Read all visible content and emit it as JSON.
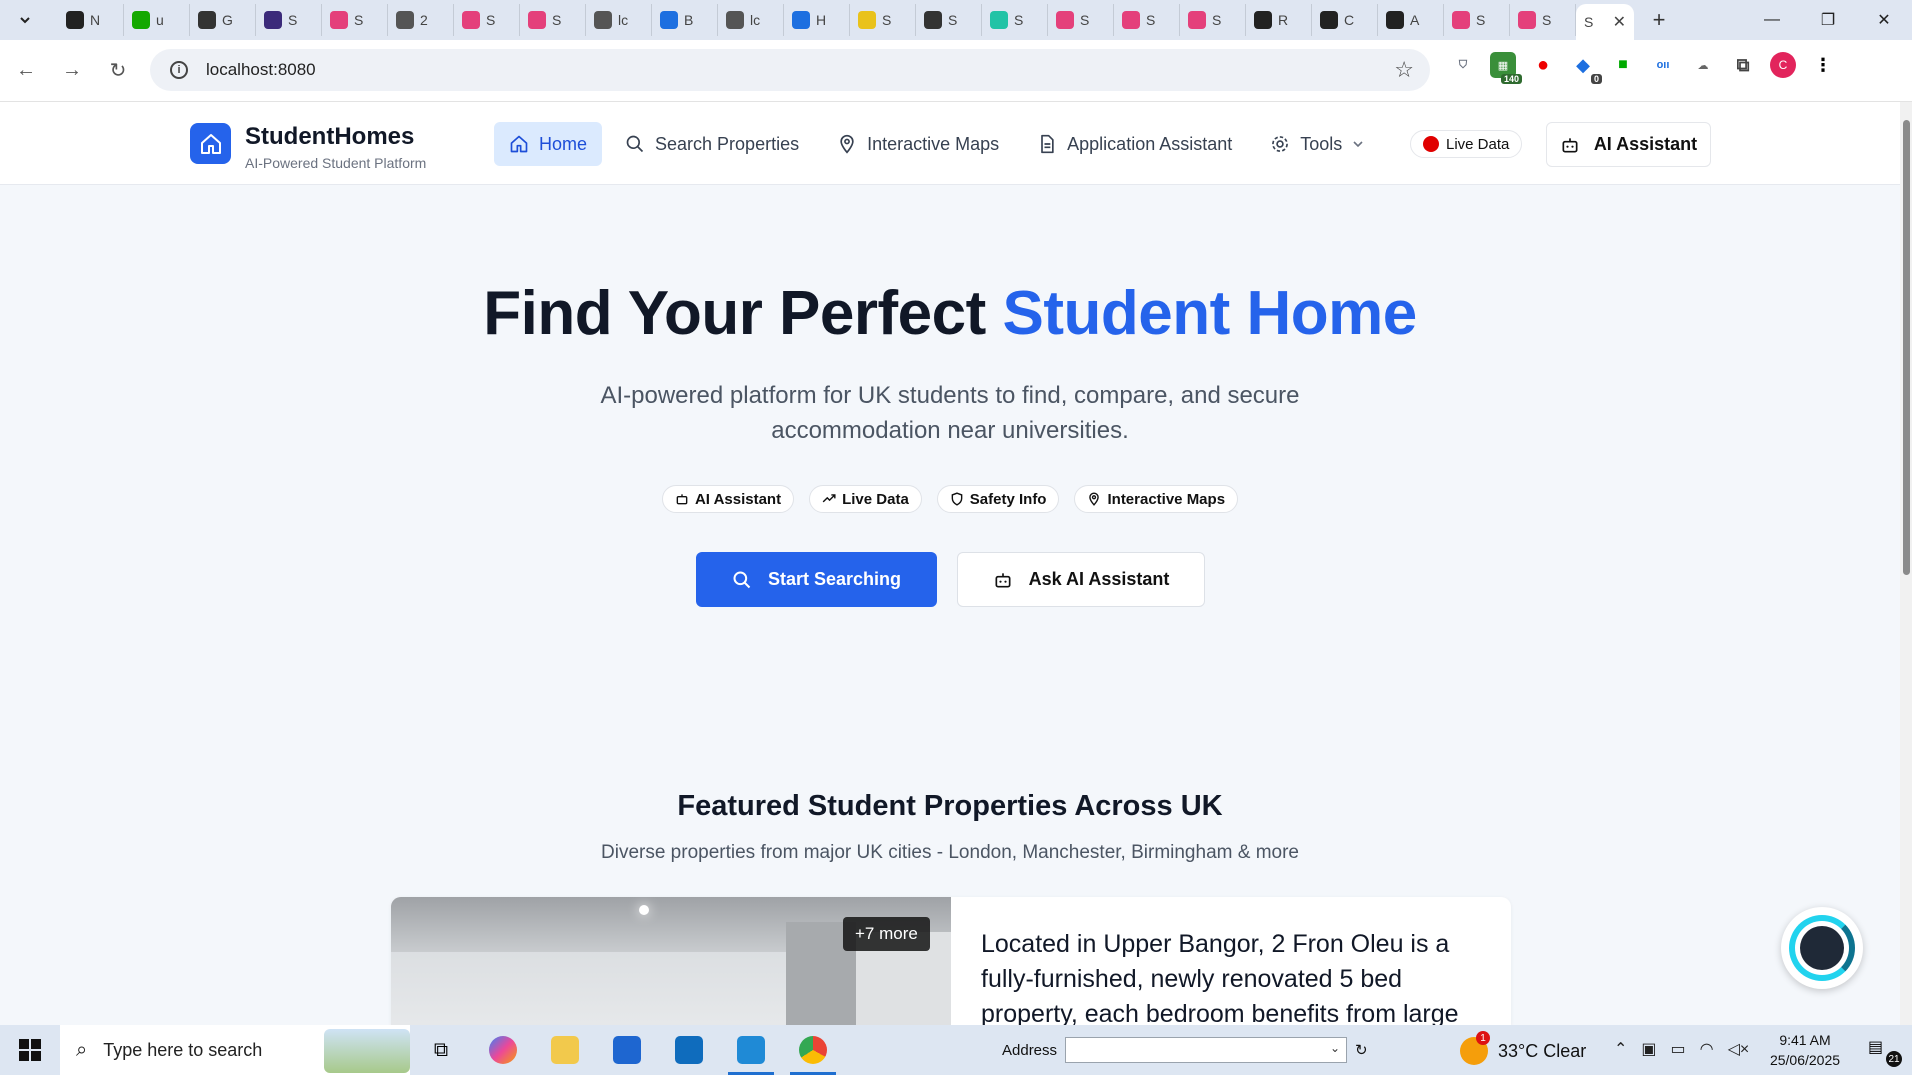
{
  "browser": {
    "tabs": [
      {
        "label": "N",
        "icon": "github-icon",
        "color": "#222222"
      },
      {
        "label": "u",
        "icon": "upwork-icon",
        "color": "#14a800"
      },
      {
        "label": "G",
        "icon": "link-icon",
        "color": "#333333"
      },
      {
        "label": "S",
        "icon": "app-icon",
        "color": "#3b2a7a"
      },
      {
        "label": "S",
        "icon": "lovable-icon",
        "color": "#e4407b"
      },
      {
        "label": "2",
        "icon": "globe-icon",
        "color": "#555555"
      },
      {
        "label": "S",
        "icon": "lovable-icon",
        "color": "#e4407b"
      },
      {
        "label": "S",
        "icon": "lovable-icon",
        "color": "#e4407b"
      },
      {
        "label": "lc",
        "icon": "globe-icon",
        "color": "#555555"
      },
      {
        "label": "B",
        "icon": "info-icon",
        "color": "#1d6fe0"
      },
      {
        "label": "lc",
        "icon": "globe-icon",
        "color": "#555555"
      },
      {
        "label": "H",
        "icon": "history-icon",
        "color": "#1d6fe0"
      },
      {
        "label": "S",
        "icon": "sun-icon",
        "color": "#e9c21b"
      },
      {
        "label": "S",
        "icon": "spiral-icon",
        "color": "#333333"
      },
      {
        "label": "S",
        "icon": "home-icon",
        "color": "#22c3a6"
      },
      {
        "label": "S",
        "icon": "lovable-icon",
        "color": "#e4407b"
      },
      {
        "label": "S",
        "icon": "lovable-icon",
        "color": "#e4407b"
      },
      {
        "label": "S",
        "icon": "lovable-icon",
        "color": "#e4407b"
      },
      {
        "label": "R",
        "icon": "app-icon",
        "color": "#222222"
      },
      {
        "label": "C",
        "icon": "app-icon",
        "color": "#222222"
      },
      {
        "label": "A",
        "icon": "app-icon",
        "color": "#222222"
      },
      {
        "label": "S",
        "icon": "lovable-icon",
        "color": "#e4407b"
      },
      {
        "label": "S",
        "icon": "lovable-icon",
        "color": "#e4407b"
      }
    ],
    "active_tab_label": "S",
    "url": "localhost:8080",
    "ext_badge_1": "140",
    "ext_badge_2": "0",
    "profile_initial": "C"
  },
  "header": {
    "brand_title": "StudentHomes",
    "brand_subtitle": "AI-Powered Student Platform",
    "nav": [
      {
        "label": "Home",
        "icon": "home-icon",
        "active": true
      },
      {
        "label": "Search Properties",
        "icon": "search-icon",
        "active": false
      },
      {
        "label": "Interactive Maps",
        "icon": "map-pin-icon",
        "active": false
      },
      {
        "label": "Application Assistant",
        "icon": "document-icon",
        "active": false
      },
      {
        "label": "Tools",
        "icon": "gear-icon",
        "active": false
      }
    ],
    "live_label": "Live Data",
    "ai_label": "AI Assistant"
  },
  "hero": {
    "title_main": "Find Your Perfect ",
    "title_accent": "Student Home",
    "subtitle": "AI-powered platform for UK students to find, compare, and secure accommodation near universities.",
    "chips": [
      {
        "label": "AI Assistant",
        "icon": "bot-icon"
      },
      {
        "label": "Live Data",
        "icon": "trend-icon"
      },
      {
        "label": "Safety Info",
        "icon": "shield-icon"
      },
      {
        "label": "Interactive Maps",
        "icon": "map-pin-icon"
      }
    ],
    "cta_primary": "Start Searching",
    "cta_secondary": "Ask AI Assistant"
  },
  "featured": {
    "title": "Featured Student Properties Across UK",
    "subtitle": "Diverse properties from major UK cities - London, Manchester, Birmingham & more",
    "card": {
      "more_badge": "+7 more",
      "description": "Located in Upper Bangor, 2 Fron Oleu is a fully-furnished, newly renovated 5 bed property, each bedroom benefits from large"
    }
  },
  "taskbar": {
    "search_placeholder": "Type here to search",
    "address_label": "Address",
    "weather_badge": "1",
    "weather": "33°C  Clear",
    "time": "9:41 AM",
    "date": "25/06/2025",
    "notifications": "21"
  }
}
